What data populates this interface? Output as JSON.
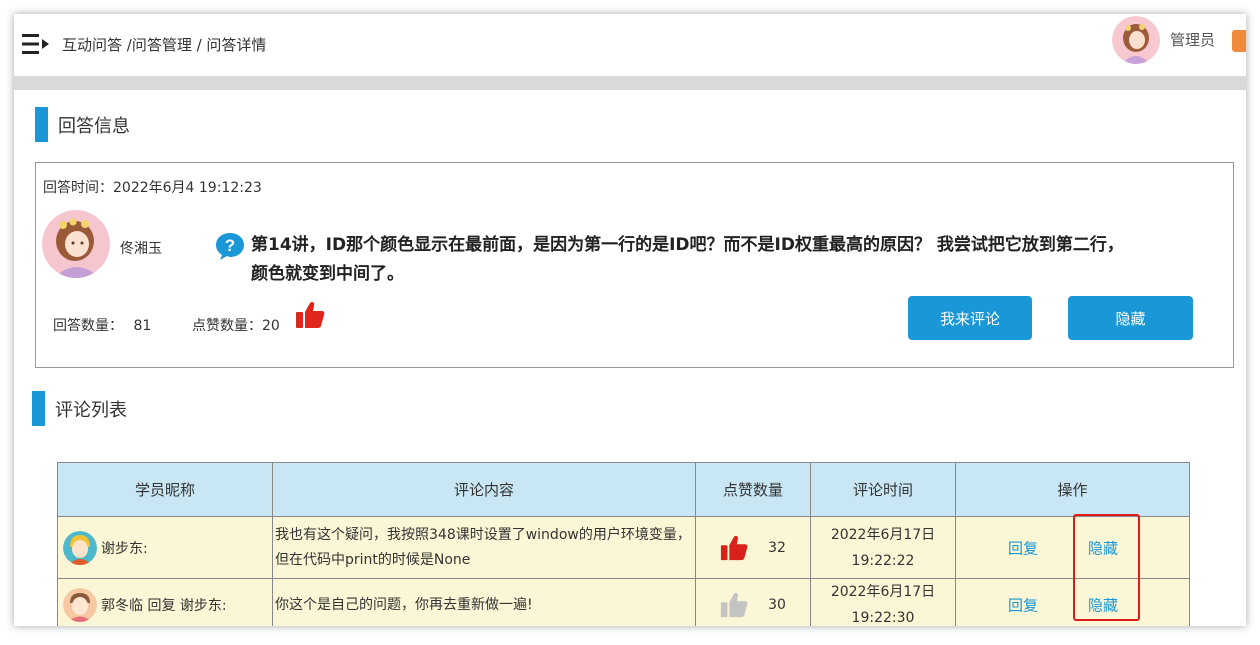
{
  "header": {
    "breadcrumb": "互动问答 /问答管理 / 问答详情",
    "admin_name": "管理员",
    "accent": "#1a97d6"
  },
  "answer_section": {
    "title": "回答信息",
    "time_label": "回答时间：2022年6月4 19:12:23",
    "user_name": "佟湘玉",
    "content": "第14讲，ID那个颜色显示在最前面，是因为第一行的是ID吧？而不是ID权重最高的原因？ 我尝试把它放到第二行，颜色就变到中间了。",
    "answers_count_label": "回答数量：",
    "answers_count": "81",
    "likes_count_label": "点赞数量：",
    "likes_count": "20",
    "comment_button": "我来评论",
    "hide_button": "隐藏"
  },
  "comment_section": {
    "title": "评论列表",
    "columns": [
      "学员昵称",
      "评论内容",
      "点赞数量",
      "评论时间",
      "操作"
    ],
    "rows": [
      {
        "nickname": "谢步东:",
        "content": "我也有这个疑问，我按照348课时设置了window的用户环境变量，但在代码中print的时候是None",
        "likes": "32",
        "liked": true,
        "time_date": "2022年6月17日",
        "time_clock": "19:22:22",
        "reply": "回复",
        "hide": "隐藏"
      },
      {
        "nickname": "郭冬临 回复 谢步东:",
        "content": "你这个是自己的问题，你再去重新做一遍!",
        "likes": "30",
        "liked": false,
        "time_date": "2022年6月17日",
        "time_clock": "19:22:30",
        "reply": "回复",
        "hide": "隐藏"
      }
    ]
  }
}
